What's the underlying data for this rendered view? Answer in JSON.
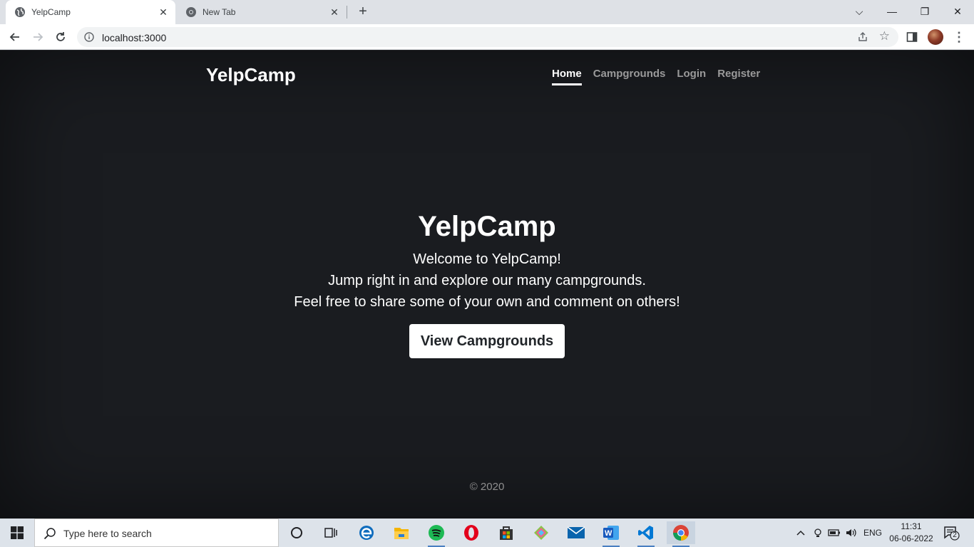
{
  "browser": {
    "tabs": [
      {
        "title": "YelpCamp",
        "active": true
      },
      {
        "title": "New Tab",
        "active": false
      }
    ],
    "new_tab_label": "+",
    "address": "localhost:3000"
  },
  "navbar": {
    "brand": "YelpCamp",
    "links": [
      {
        "label": "Home",
        "active": true
      },
      {
        "label": "Campgrounds",
        "active": false
      },
      {
        "label": "Login",
        "active": false
      },
      {
        "label": "Register",
        "active": false
      }
    ]
  },
  "hero": {
    "title": "YelpCamp",
    "lines": [
      "Welcome to YelpCamp!",
      "Jump right in and explore our many campgrounds.",
      "Feel free to share some of your own and comment on others!"
    ],
    "button_label": "View Campgrounds"
  },
  "footer": {
    "text": "© 2020"
  },
  "taskbar": {
    "search_placeholder": "Type here to search",
    "apps": [
      "cortana-icon",
      "task-view-icon",
      "edge-icon",
      "file-explorer-icon",
      "spotify-icon",
      "opera-icon",
      "store-icon",
      "sourcetree-icon",
      "mail-icon",
      "word-icon",
      "vscode-icon",
      "chrome-icon"
    ],
    "language": "ENG",
    "time": "11:31",
    "date": "06-06-2022",
    "notification_count": "2"
  },
  "colors": {
    "page_bg": "#1a1c20",
    "button_bg": "#ffffff",
    "nav_inactive": "#9a9a9a"
  }
}
